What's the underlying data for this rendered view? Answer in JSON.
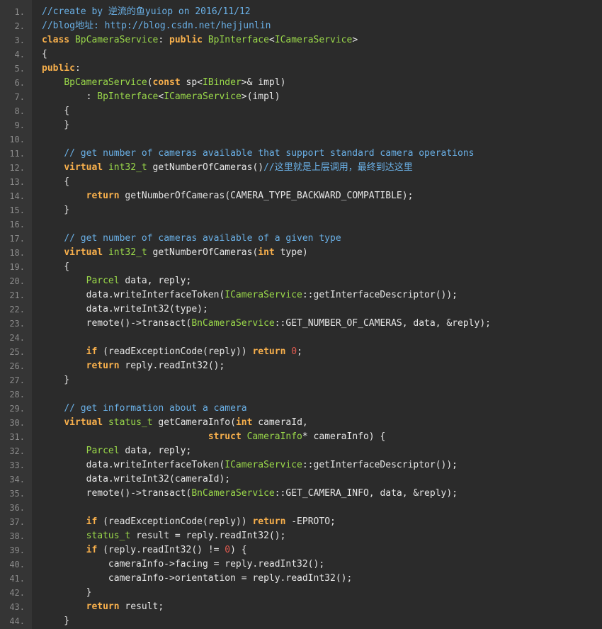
{
  "editor": {
    "colors": {
      "background": "#2b2b2b",
      "gutter": "#353535",
      "line_number": "#8a8a8a",
      "plain": "#e6e6e6",
      "keyword": "#f8b04c",
      "type": "#9ad84a",
      "comment": "#6ab0e6",
      "number": "#e05a4f"
    },
    "lines": [
      {
        "num": "1.",
        "segments": [
          {
            "t": "//create by 逆流的鱼yuiop on 2016/11/12",
            "c": "cmt"
          }
        ]
      },
      {
        "num": "2.",
        "segments": [
          {
            "t": "//blog地址: http://blog.csdn.net/hejjunlin",
            "c": "cmt"
          }
        ]
      },
      {
        "num": "3.",
        "segments": [
          {
            "t": "class",
            "c": "kw"
          },
          {
            "t": " "
          },
          {
            "t": "BpCameraService",
            "c": "type"
          },
          {
            "t": ": "
          },
          {
            "t": "public",
            "c": "kw"
          },
          {
            "t": " "
          },
          {
            "t": "BpInterface",
            "c": "type"
          },
          {
            "t": "<"
          },
          {
            "t": "ICameraService",
            "c": "type"
          },
          {
            "t": ">"
          }
        ]
      },
      {
        "num": "4.",
        "segments": [
          {
            "t": "{"
          }
        ]
      },
      {
        "num": "5.",
        "segments": [
          {
            "t": "public",
            "c": "kw"
          },
          {
            "t": ":"
          }
        ]
      },
      {
        "num": "6.",
        "segments": [
          {
            "t": "    "
          },
          {
            "t": "BpCameraService",
            "c": "type"
          },
          {
            "t": "("
          },
          {
            "t": "const",
            "c": "kw"
          },
          {
            "t": " sp<"
          },
          {
            "t": "IBinder",
            "c": "type"
          },
          {
            "t": ">& impl)"
          }
        ]
      },
      {
        "num": "7.",
        "segments": [
          {
            "t": "        : "
          },
          {
            "t": "BpInterface",
            "c": "type"
          },
          {
            "t": "<"
          },
          {
            "t": "ICameraService",
            "c": "type"
          },
          {
            "t": ">(impl)"
          }
        ]
      },
      {
        "num": "8.",
        "segments": [
          {
            "t": "    {"
          }
        ]
      },
      {
        "num": "9.",
        "segments": [
          {
            "t": "    }"
          }
        ]
      },
      {
        "num": "10.",
        "segments": []
      },
      {
        "num": "11.",
        "segments": [
          {
            "t": "    "
          },
          {
            "t": "// get number of cameras available that support standard camera operations",
            "c": "cmt"
          }
        ]
      },
      {
        "num": "12.",
        "segments": [
          {
            "t": "    "
          },
          {
            "t": "virtual",
            "c": "kw"
          },
          {
            "t": " "
          },
          {
            "t": "int32_t",
            "c": "type"
          },
          {
            "t": " getNumberOfCameras()"
          },
          {
            "t": "//这里就是上层调用，最终到达这里",
            "c": "cmt"
          }
        ]
      },
      {
        "num": "13.",
        "segments": [
          {
            "t": "    {"
          }
        ]
      },
      {
        "num": "14.",
        "segments": [
          {
            "t": "        "
          },
          {
            "t": "return",
            "c": "kw"
          },
          {
            "t": " getNumberOfCameras(CAMERA_TYPE_BACKWARD_COMPATIBLE);"
          }
        ]
      },
      {
        "num": "15.",
        "segments": [
          {
            "t": "    }"
          }
        ]
      },
      {
        "num": "16.",
        "segments": []
      },
      {
        "num": "17.",
        "segments": [
          {
            "t": "    "
          },
          {
            "t": "// get number of cameras available of a given type",
            "c": "cmt"
          }
        ]
      },
      {
        "num": "18.",
        "segments": [
          {
            "t": "    "
          },
          {
            "t": "virtual",
            "c": "kw"
          },
          {
            "t": " "
          },
          {
            "t": "int32_t",
            "c": "type"
          },
          {
            "t": " getNumberOfCameras("
          },
          {
            "t": "int",
            "c": "kw"
          },
          {
            "t": " type)"
          }
        ]
      },
      {
        "num": "19.",
        "segments": [
          {
            "t": "    {"
          }
        ]
      },
      {
        "num": "20.",
        "segments": [
          {
            "t": "        "
          },
          {
            "t": "Parcel",
            "c": "type"
          },
          {
            "t": " data, reply;"
          }
        ]
      },
      {
        "num": "21.",
        "segments": [
          {
            "t": "        data.writeInterfaceToken("
          },
          {
            "t": "ICameraService",
            "c": "type"
          },
          {
            "t": "::getInterfaceDescriptor());"
          }
        ]
      },
      {
        "num": "22.",
        "segments": [
          {
            "t": "        data.writeInt32(type);"
          }
        ]
      },
      {
        "num": "23.",
        "segments": [
          {
            "t": "        remote()->transact("
          },
          {
            "t": "BnCameraService",
            "c": "type"
          },
          {
            "t": "::GET_NUMBER_OF_CAMERAS, data, &reply);"
          }
        ]
      },
      {
        "num": "24.",
        "segments": []
      },
      {
        "num": "25.",
        "segments": [
          {
            "t": "        "
          },
          {
            "t": "if",
            "c": "kw"
          },
          {
            "t": " (readExceptionCode(reply)) "
          },
          {
            "t": "return",
            "c": "kw"
          },
          {
            "t": " "
          },
          {
            "t": "0",
            "c": "num"
          },
          {
            "t": ";"
          }
        ]
      },
      {
        "num": "26.",
        "segments": [
          {
            "t": "        "
          },
          {
            "t": "return",
            "c": "kw"
          },
          {
            "t": " reply.readInt32();"
          }
        ]
      },
      {
        "num": "27.",
        "segments": [
          {
            "t": "    }"
          }
        ]
      },
      {
        "num": "28.",
        "segments": []
      },
      {
        "num": "29.",
        "segments": [
          {
            "t": "    "
          },
          {
            "t": "// get information about a camera",
            "c": "cmt"
          }
        ]
      },
      {
        "num": "30.",
        "segments": [
          {
            "t": "    "
          },
          {
            "t": "virtual",
            "c": "kw"
          },
          {
            "t": " "
          },
          {
            "t": "status_t",
            "c": "type"
          },
          {
            "t": " getCameraInfo("
          },
          {
            "t": "int",
            "c": "kw"
          },
          {
            "t": " cameraId,"
          }
        ]
      },
      {
        "num": "31.",
        "segments": [
          {
            "t": "                              "
          },
          {
            "t": "struct",
            "c": "kw"
          },
          {
            "t": " "
          },
          {
            "t": "CameraInfo",
            "c": "type"
          },
          {
            "t": "* cameraInfo) {"
          }
        ]
      },
      {
        "num": "32.",
        "segments": [
          {
            "t": "        "
          },
          {
            "t": "Parcel",
            "c": "type"
          },
          {
            "t": " data, reply;"
          }
        ]
      },
      {
        "num": "33.",
        "segments": [
          {
            "t": "        data.writeInterfaceToken("
          },
          {
            "t": "ICameraService",
            "c": "type"
          },
          {
            "t": "::getInterfaceDescriptor());"
          }
        ]
      },
      {
        "num": "34.",
        "segments": [
          {
            "t": "        data.writeInt32(cameraId);"
          }
        ]
      },
      {
        "num": "35.",
        "segments": [
          {
            "t": "        remote()->transact("
          },
          {
            "t": "BnCameraService",
            "c": "type"
          },
          {
            "t": "::GET_CAMERA_INFO, data, &reply);"
          }
        ]
      },
      {
        "num": "36.",
        "segments": []
      },
      {
        "num": "37.",
        "segments": [
          {
            "t": "        "
          },
          {
            "t": "if",
            "c": "kw"
          },
          {
            "t": " (readExceptionCode(reply)) "
          },
          {
            "t": "return",
            "c": "kw"
          },
          {
            "t": " -EPROTO;"
          }
        ]
      },
      {
        "num": "38.",
        "segments": [
          {
            "t": "        "
          },
          {
            "t": "status_t",
            "c": "type"
          },
          {
            "t": " result = reply.readInt32();"
          }
        ]
      },
      {
        "num": "39.",
        "segments": [
          {
            "t": "        "
          },
          {
            "t": "if",
            "c": "kw"
          },
          {
            "t": " (reply.readInt32() != "
          },
          {
            "t": "0",
            "c": "num"
          },
          {
            "t": ") {"
          }
        ]
      },
      {
        "num": "40.",
        "segments": [
          {
            "t": "            cameraInfo->facing = reply.readInt32();"
          }
        ]
      },
      {
        "num": "41.",
        "segments": [
          {
            "t": "            cameraInfo->orientation = reply.readInt32();"
          }
        ]
      },
      {
        "num": "42.",
        "segments": [
          {
            "t": "        }"
          }
        ]
      },
      {
        "num": "43.",
        "segments": [
          {
            "t": "        "
          },
          {
            "t": "return",
            "c": "kw"
          },
          {
            "t": " result;"
          }
        ]
      },
      {
        "num": "44.",
        "segments": [
          {
            "t": "    }"
          }
        ]
      }
    ]
  }
}
